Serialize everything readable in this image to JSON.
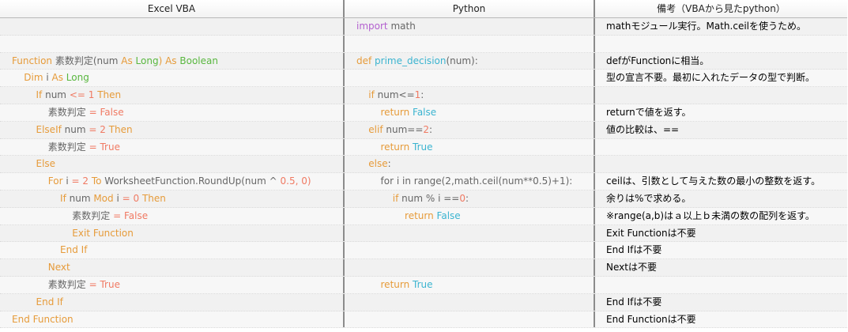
{
  "headers": {
    "vba": "Excel VBA",
    "python": "Python",
    "notes": "備考（VBAから見たpython）"
  },
  "rows": [
    {
      "vba": [],
      "py": [
        [
          "pk",
          "import"
        ],
        [
          "ws",
          " math"
        ]
      ],
      "note": "mathモジュール実行。Math.ceilを使うため。"
    },
    {
      "vba": [],
      "py": [],
      "note": ""
    },
    {
      "vba": [
        [
          "kw",
          "Function "
        ],
        [
          "ws",
          "素数判定(num "
        ],
        [
          "kw",
          "As "
        ],
        [
          "ty",
          "Long"
        ],
        [
          "kw",
          ") As "
        ],
        [
          "ty",
          "Boolean"
        ]
      ],
      "py": [
        [
          "kw",
          "def "
        ],
        [
          "fn",
          "prime_decision"
        ],
        [
          "ws",
          "(num):"
        ]
      ],
      "note": "defがFunctionに相当。"
    },
    {
      "vba": [
        [
          "ws",
          "    "
        ],
        [
          "kw",
          "Dim "
        ],
        [
          "ws",
          "i "
        ],
        [
          "kw",
          "As "
        ],
        [
          "ty",
          "Long"
        ]
      ],
      "py": [],
      "note": "型の宣言不要。最初に入れたデータの型で判断。"
    },
    {
      "vba": [
        [
          "ws",
          "        "
        ],
        [
          "kw",
          "If "
        ],
        [
          "ws",
          "num "
        ],
        [
          "nm",
          "<= 1 "
        ],
        [
          "kw",
          "Then"
        ]
      ],
      "py": [
        [
          "ws",
          "    "
        ],
        [
          "kw",
          "if "
        ],
        [
          "ws",
          "num<="
        ],
        [
          "nm",
          "1"
        ],
        [
          "ws",
          ":"
        ]
      ],
      "note": ""
    },
    {
      "vba": [
        [
          "ws",
          "            素数判定 "
        ],
        [
          "nm",
          "= False"
        ]
      ],
      "py": [
        [
          "ws",
          "        "
        ],
        [
          "kw",
          "return "
        ],
        [
          "ct",
          "False"
        ]
      ],
      "note": "returnで値を返す。"
    },
    {
      "vba": [
        [
          "ws",
          "        "
        ],
        [
          "kw",
          "ElseIf "
        ],
        [
          "ws",
          "num "
        ],
        [
          "nm",
          "= 2 "
        ],
        [
          "kw",
          "Then"
        ]
      ],
      "py": [
        [
          "ws",
          "    "
        ],
        [
          "kw",
          "elif "
        ],
        [
          "ws",
          "num=="
        ],
        [
          "nm",
          "2"
        ],
        [
          "ws",
          ":"
        ]
      ],
      "note": "値の比較は、=="
    },
    {
      "vba": [
        [
          "ws",
          "            素数判定 "
        ],
        [
          "nm",
          "= True"
        ]
      ],
      "py": [
        [
          "ws",
          "        "
        ],
        [
          "kw",
          "return "
        ],
        [
          "ct",
          "True"
        ]
      ],
      "note": ""
    },
    {
      "vba": [
        [
          "ws",
          "        "
        ],
        [
          "kw",
          "Else"
        ]
      ],
      "py": [
        [
          "ws",
          "    "
        ],
        [
          "kw",
          "else"
        ],
        [
          "ws",
          ":"
        ]
      ],
      "note": ""
    },
    {
      "vba": [
        [
          "ws",
          "            "
        ],
        [
          "kw",
          "For "
        ],
        [
          "ws",
          "i "
        ],
        [
          "nm",
          "= 2 "
        ],
        [
          "kw",
          "To "
        ],
        [
          "ws",
          "WorksheetFunction.RoundUp(num ^ "
        ],
        [
          "nm",
          "0.5, 0)"
        ]
      ],
      "py": [
        [
          "ws",
          "        "
        ],
        [
          "ws",
          "for i in range(2,math.ceil(num**0.5)+1):"
        ]
      ],
      "note": "ceilは、引数として与えた数の最小の整数を返す。"
    },
    {
      "vba": [
        [
          "ws",
          "                "
        ],
        [
          "kw",
          "If "
        ],
        [
          "ws",
          "num "
        ],
        [
          "kw",
          "Mod "
        ],
        [
          "ws",
          "i "
        ],
        [
          "nm",
          "= 0 "
        ],
        [
          "kw",
          "Then"
        ]
      ],
      "py": [
        [
          "ws",
          "            "
        ],
        [
          "kw",
          "if "
        ],
        [
          "ws",
          "num % i =="
        ],
        [
          "nm",
          "0"
        ],
        [
          "ws",
          ":"
        ]
      ],
      "note": "余りは%で求める。"
    },
    {
      "vba": [
        [
          "ws",
          "                    素数判定 "
        ],
        [
          "nm",
          "= False"
        ]
      ],
      "py": [
        [
          "ws",
          "                "
        ],
        [
          "kw",
          "return "
        ],
        [
          "ct",
          "False"
        ]
      ],
      "note": "※range(a,b)はａ以上ｂ未満の数の配列を返す。"
    },
    {
      "vba": [
        [
          "ws",
          "                    "
        ],
        [
          "kw",
          "Exit Function"
        ]
      ],
      "py": [],
      "note": "Exit Functionは不要"
    },
    {
      "vba": [
        [
          "ws",
          "                "
        ],
        [
          "kw",
          "End If"
        ]
      ],
      "py": [],
      "note": "End Ifは不要"
    },
    {
      "vba": [
        [
          "ws",
          "            "
        ],
        [
          "kw",
          "Next"
        ]
      ],
      "py": [],
      "note": "Nextは不要"
    },
    {
      "vba": [
        [
          "ws",
          "            素数判定 "
        ],
        [
          "nm",
          "= True"
        ]
      ],
      "py": [
        [
          "ws",
          "        "
        ],
        [
          "kw",
          "return "
        ],
        [
          "ct",
          "True"
        ]
      ],
      "note": ""
    },
    {
      "vba": [
        [
          "ws",
          "        "
        ],
        [
          "kw",
          "End If"
        ]
      ],
      "py": [],
      "note": "End Ifは不要"
    },
    {
      "vba": [
        [
          "kw",
          "End Function"
        ]
      ],
      "py": [],
      "note": "End Functionは不要"
    }
  ]
}
